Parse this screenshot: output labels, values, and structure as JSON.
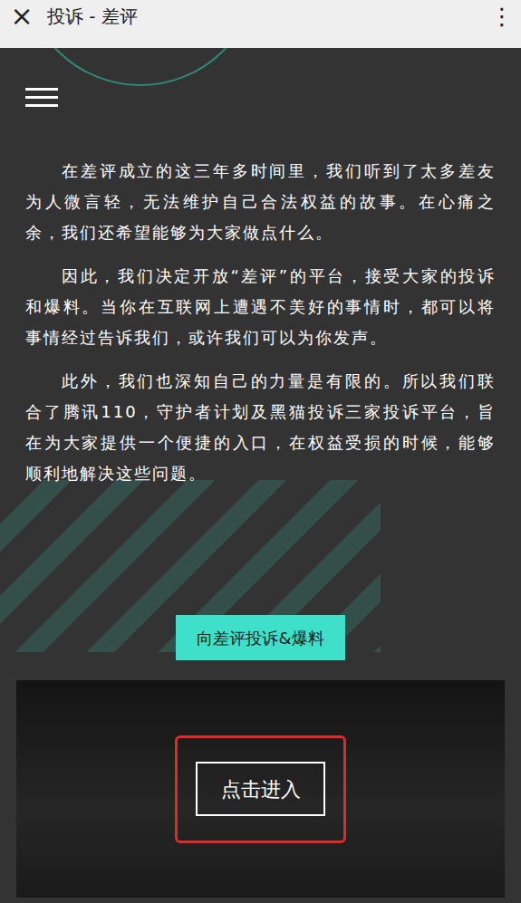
{
  "window": {
    "title": "投诉 - 差评",
    "close": "×",
    "more": "⋮"
  },
  "intro": {
    "paragraphs": [
      "在差评成立的这三年多时间里，我们听到了太多差友为人微言轻，无法维护自己合法权益的故事。在心痛之余，我们还希望能够为大家做点什么。",
      "因此，我们决定开放“差评”的平台，接受大家的投诉和爆料。当你在互联网上遭遇不美好的事情时，都可以将事情经过告诉我们，或许我们可以为你发声。",
      "此外，我们也深知自己的力量是有限的。所以我们联合了腾讯110，守护者计划及黑猫投诉三家投诉平台，旨在为大家提供一个便捷的入口，在权益受损的时候，能够顺利地解决这些问题。"
    ]
  },
  "complain_button": "向差评投诉&爆料",
  "entry": {
    "label": "点击进入"
  }
}
